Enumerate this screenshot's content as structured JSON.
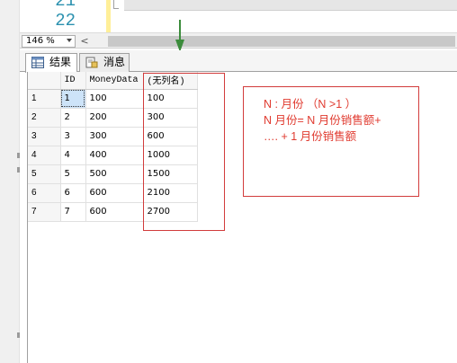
{
  "editor": {
    "line_numbers": [
      "21",
      "22"
    ]
  },
  "zoom": {
    "level": "146 %",
    "scroll_left_glyph": "<"
  },
  "tabs": [
    {
      "label": "结果",
      "icon": "grid-icon",
      "active": true
    },
    {
      "label": "消息",
      "icon": "message-icon",
      "active": false
    }
  ],
  "grid": {
    "columns": [
      "ID",
      "MoneyData",
      "(无列名)"
    ],
    "rows": [
      {
        "num": "1",
        "id": "1",
        "money": "100",
        "sum": "100"
      },
      {
        "num": "2",
        "id": "2",
        "money": "200",
        "sum": "300"
      },
      {
        "num": "3",
        "id": "3",
        "money": "300",
        "sum": "600"
      },
      {
        "num": "4",
        "id": "4",
        "money": "400",
        "sum": "1000"
      },
      {
        "num": "5",
        "id": "5",
        "money": "500",
        "sum": "1500"
      },
      {
        "num": "6",
        "id": "6",
        "money": "600",
        "sum": "2100"
      },
      {
        "num": "7",
        "id": "7",
        "money": "600",
        "sum": "2700"
      }
    ]
  },
  "annotation": {
    "lines": [
      "N : 月份 （N >1 ）",
      "N 月份= N 月份销售额+",
      "…. + 1 月份销售额"
    ],
    "color": "#e03a2f"
  }
}
